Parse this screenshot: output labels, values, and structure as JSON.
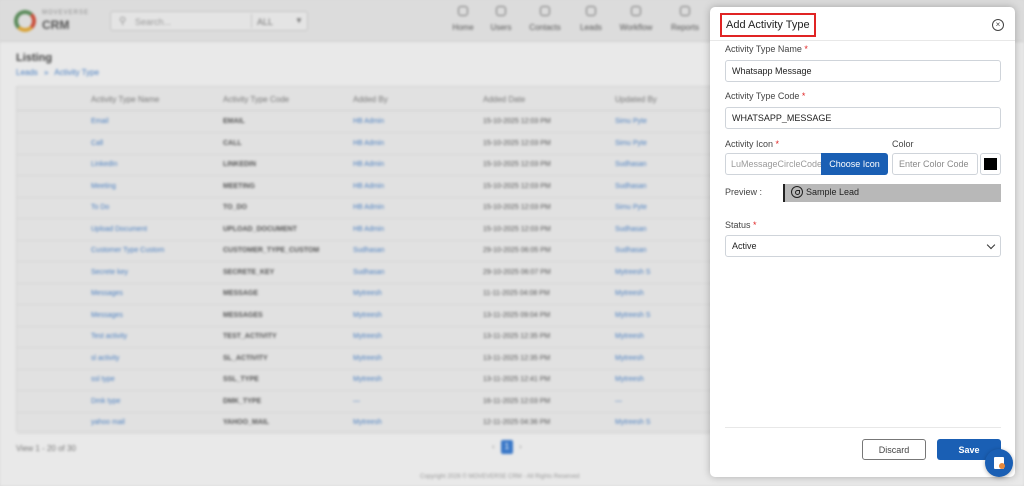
{
  "topbar": {
    "brand_small": "MOVEVERSE",
    "brand_big": "CRM",
    "search_placeholder": "Search...",
    "search_scope": "ALL",
    "nav": [
      "Home",
      "Users",
      "Contacts",
      "Leads",
      "Workflow",
      "Reports"
    ]
  },
  "page": {
    "title": "Listing",
    "breadcrumbs": [
      "Leads",
      "»",
      "Activity Type"
    ]
  },
  "table": {
    "columns": [
      "Activity Type Name",
      "Activity Type Code",
      "Added By",
      "Added Date",
      "Updated By"
    ],
    "rows": [
      [
        "Email",
        "EMAIL",
        "HB Admin",
        "15-10-2025 12:03 PM",
        "Simu Pyte"
      ],
      [
        "Call",
        "CALL",
        "HB Admin",
        "15-10-2025 12:03 PM",
        "Simu Pyte"
      ],
      [
        "LinkedIn",
        "LINKEDIN",
        "HB Admin",
        "15-10-2025 12:03 PM",
        "Sudhasan"
      ],
      [
        "Meeting",
        "MEETING",
        "HB Admin",
        "15-10-2025 12:03 PM",
        "Sudhasan"
      ],
      [
        "To Do",
        "TO_DO",
        "HB Admin",
        "15-10-2025 12:03 PM",
        "Simu Pyte"
      ],
      [
        "Upload Document",
        "UPLOAD_DOCUMENT",
        "HB Admin",
        "15-10-2025 12:03 PM",
        "Sudhasan"
      ],
      [
        "Customer Type Custom",
        "CUSTOMER_TYPE_CUSTOM",
        "Sudhasan",
        "29-10-2025 06:05 PM",
        "Sudhasan"
      ],
      [
        "Secrete key",
        "SECRETE_KEY",
        "Sudhasan",
        "29-10-2025 06:07 PM",
        "Mytreesh S"
      ],
      [
        "Messages",
        "MESSAGE",
        "Mytreesh",
        "11-11-2025 04:08 PM",
        "Mytreesh"
      ],
      [
        "Messages",
        "MESSAGES",
        "Mytreesh",
        "13-11-2025 09:04 PM",
        "Mytreesh S"
      ],
      [
        "Test activity",
        "TEST_ACTIVITY",
        "Mytreesh",
        "13-11-2025 12:35 PM",
        "Mytreesh"
      ],
      [
        "sl activity",
        "SL_ACTIVITY",
        "Mytreesh",
        "13-11-2025 12:35 PM",
        "Mytreesh"
      ],
      [
        "ssl type",
        "SSL_TYPE",
        "Mytreesh",
        "13-11-2025 12:41 PM",
        "Mytreesh"
      ],
      [
        "Dmk type",
        "DMK_TYPE",
        "—",
        "16-11-2025 12:03 PM",
        "—"
      ],
      [
        "yahoo mail",
        "YAHOO_MAIL",
        "Mytreesh",
        "12-11-2025 04:36 PM",
        "Mytreesh S"
      ]
    ]
  },
  "pagination": {
    "info": "View 1 - 20 of 30",
    "current": "1"
  },
  "footer": "Copyright 2026 © MOVEVERSE CRM - All Rights Reserved",
  "modal": {
    "title": "Add Activity Type",
    "close_glyph": "×",
    "required_mark": "*",
    "name_label": "Activity Type Name",
    "name_value": "Whatsapp Message",
    "code_label": "Activity Type Code",
    "code_value": "WHATSAPP_MESSAGE",
    "icon_label": "Activity Icon",
    "icon_value": "LuMessageCircleCode",
    "choose_icon_label": "Choose Icon",
    "color_label": "Color",
    "color_placeholder": "Enter Color Code",
    "preview_label": "Preview :",
    "preview_text": "Sample Lead",
    "status_label": "Status",
    "status_value": "Active",
    "discard_label": "Discard",
    "save_label": "Save"
  },
  "colors": {
    "primary": "#1a5fb4",
    "required": "#e02424",
    "swatch": "#000000",
    "highlight_box": "#e02424"
  },
  "icons": {
    "close": "close-circle-icon",
    "preview": "message-circle-code-icon",
    "status_caret": "chevron-down-icon",
    "fab": "report-icon"
  }
}
